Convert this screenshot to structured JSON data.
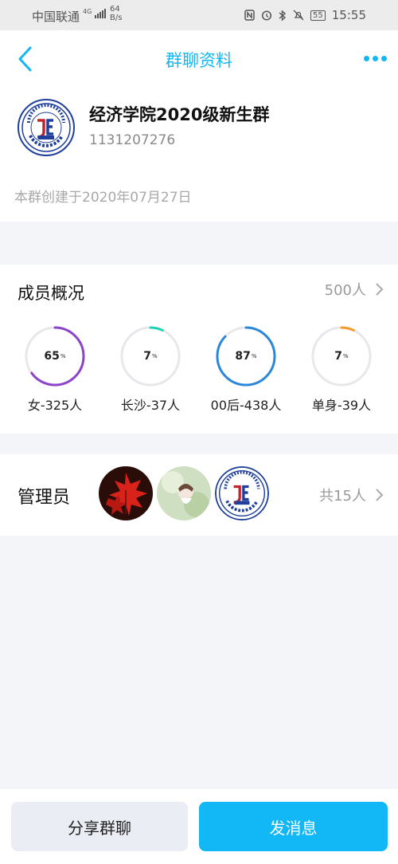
{
  "status_bar": {
    "carrier": "中国联通",
    "network": "4G",
    "speed_value": "64",
    "speed_unit": "B/s",
    "battery": "55",
    "time": "15:55"
  },
  "nav": {
    "title": "群聊资料"
  },
  "group": {
    "name": "经济学院2020级新生群",
    "id": "1131207276",
    "created": "本群创建于2020年07月27日",
    "logo_text": "SCHOOL OF ECONOMICS",
    "logo_sub": "CSUFT"
  },
  "members": {
    "title": "成员概况",
    "count": "500人",
    "stats": [
      {
        "percent": 65,
        "label": "女-325人",
        "color": "#8e44c9"
      },
      {
        "percent": 7,
        "label": "长沙-37人",
        "color": "#1fd2b4"
      },
      {
        "percent": 87,
        "label": "00后-438人",
        "color": "#2b87d8"
      },
      {
        "percent": 7,
        "label": "单身-39人",
        "color": "#f39a2a"
      }
    ],
    "ring_track_color": "#e8e8ec"
  },
  "admins": {
    "title": "管理员",
    "count": "共15人"
  },
  "actions": {
    "share": "分享群聊",
    "message": "发消息"
  },
  "colors": {
    "accent": "#12b7f5"
  }
}
